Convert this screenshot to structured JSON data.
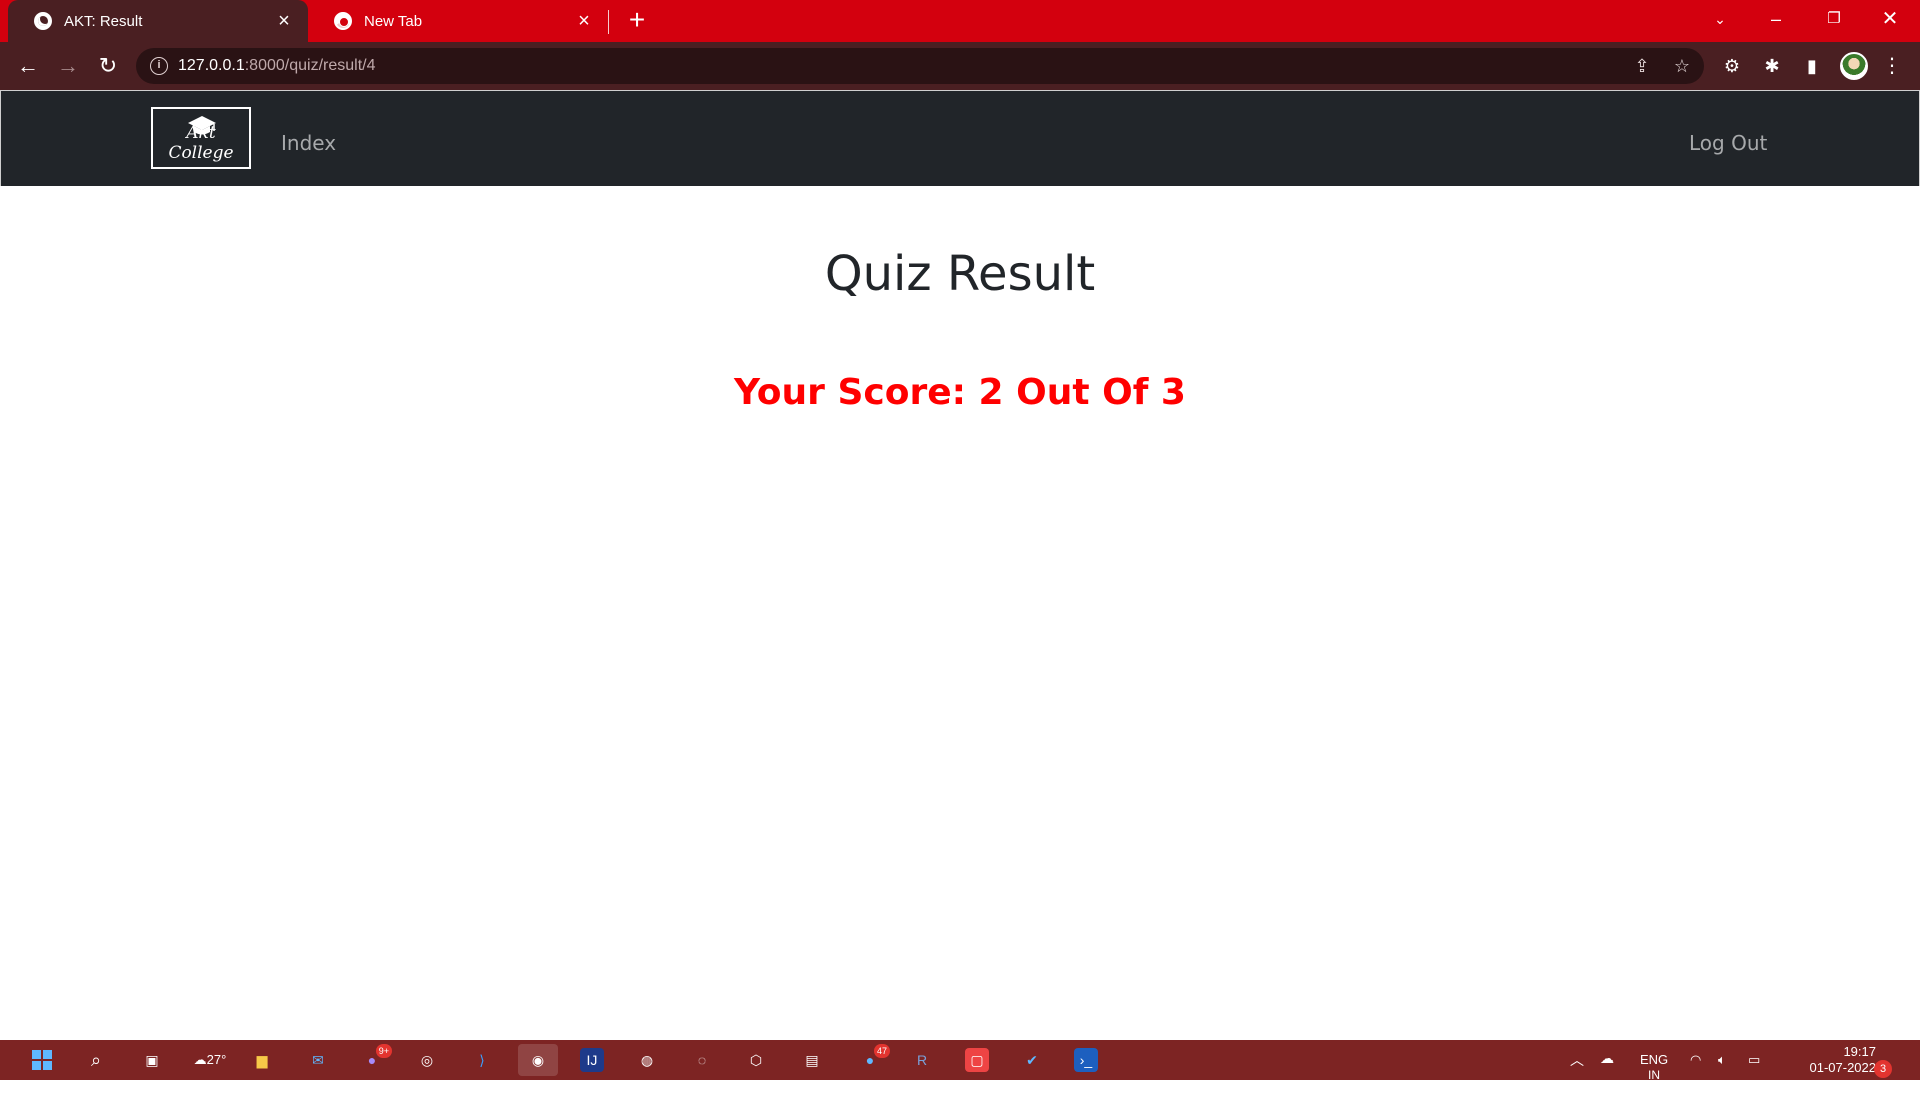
{
  "browser": {
    "tabs": [
      {
        "title": "AKT: Result",
        "active": true
      },
      {
        "title": "New Tab",
        "active": false
      }
    ],
    "url_host": "127.0.0.1",
    "url_rest": ":8000/quiz/result/4"
  },
  "site": {
    "logo_text": "Akt College",
    "nav": {
      "index": "Index",
      "logout": "Log Out"
    }
  },
  "main": {
    "title": "Quiz Result",
    "score": "Your Score: 2 Out Of 3"
  },
  "taskbar": {
    "weather": "27°",
    "language": "ENG",
    "language_sub": "IN",
    "time": "19:17",
    "date": "01-07-2022",
    "notifications": "3",
    "badge_teams": "9+",
    "badge_chat": "47"
  },
  "colors": {
    "tabstrip": "#d3000e",
    "toolbar": "#4a1f22",
    "navbar": "#212529",
    "score": "#ff0000",
    "taskbar": "#7d2423"
  }
}
